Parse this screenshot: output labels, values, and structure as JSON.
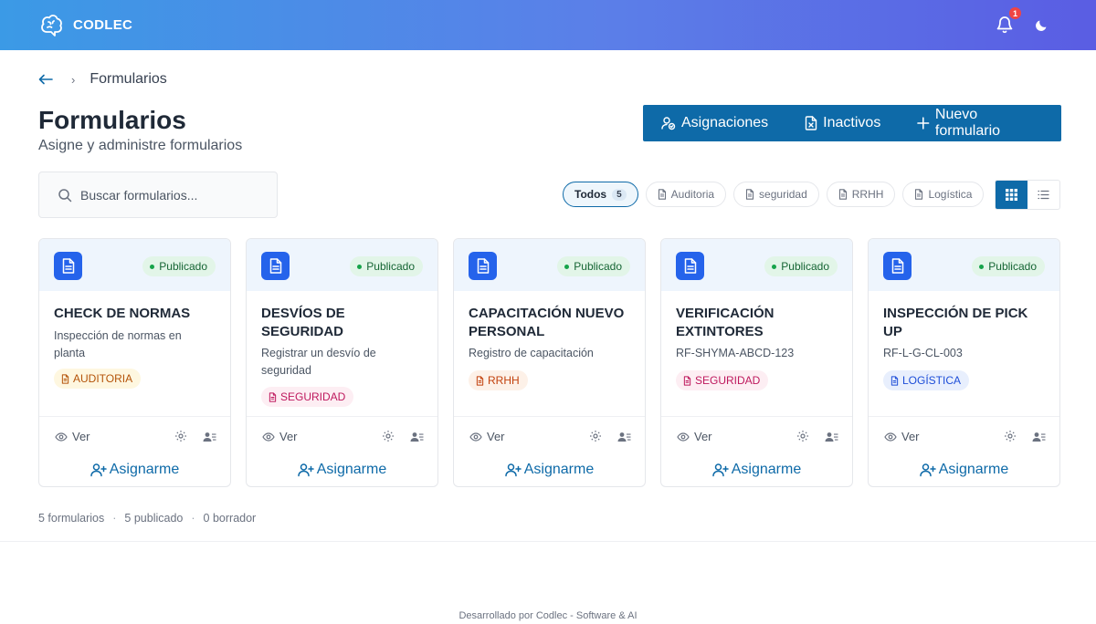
{
  "brand": {
    "name": "CODLEC"
  },
  "header": {
    "notification_count": "1"
  },
  "breadcrumb": {
    "current": "Formularios"
  },
  "page": {
    "title": "Formularios",
    "subtitle": "Asigne y administre formularios"
  },
  "actions": {
    "assignments": "Asignaciones",
    "inactive": "Inactivos",
    "new_form": "Nuevo formulario"
  },
  "search": {
    "placeholder": "Buscar formularios..."
  },
  "filters": {
    "all": {
      "label": "Todos",
      "count": "5"
    },
    "items": [
      "Auditoria",
      "seguridad",
      "RRHH",
      "Logística"
    ]
  },
  "cards": [
    {
      "status": "Publicado",
      "title": "CHECK DE NORMAS",
      "description": "Inspección de normas en planta",
      "tag": "AUDITORIA",
      "view": "Ver",
      "assign": "Asignarme"
    },
    {
      "status": "Publicado",
      "title": "DESVÍOS DE SEGURIDAD",
      "description": "Registrar un desvío de seguridad",
      "tag": "SEGURIDAD",
      "view": "Ver",
      "assign": "Asignarme"
    },
    {
      "status": "Publicado",
      "title": "CAPACITACIÓN NUEVO PERSONAL",
      "description": "Registro de capacitación",
      "tag": "RRHH",
      "view": "Ver",
      "assign": "Asignarme"
    },
    {
      "status": "Publicado",
      "title": "VERIFICACIÓN EXTINTORES",
      "description": "RF-SHYMA-ABCD-123",
      "tag": "SEGURIDAD",
      "view": "Ver",
      "assign": "Asignarme"
    },
    {
      "status": "Publicado",
      "title": "INSPECCIÓN DE PICK UP",
      "description": "RF-L-G-CL-003",
      "tag": "LOGÍSTICA",
      "view": "Ver",
      "assign": "Asignarme"
    }
  ],
  "summary": {
    "forms": "5 formularios",
    "published": "5 publicado",
    "drafts": "0 borrador"
  },
  "footer": {
    "text": "Desarrollado por Codlec - Software & AI"
  },
  "colors": {
    "primary": "#0e6aa8",
    "header_start": "#3b9ae6",
    "header_end": "#5a5de3",
    "published": "#16a34a"
  }
}
